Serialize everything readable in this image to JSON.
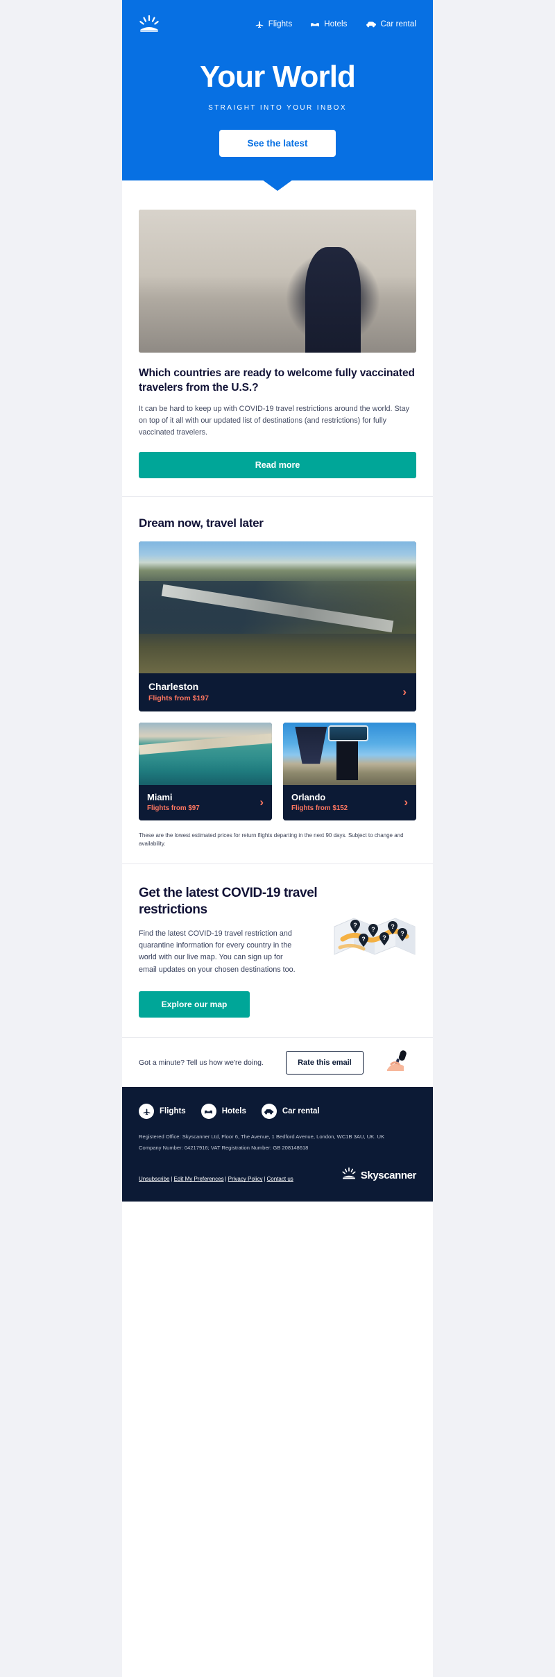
{
  "brand": {
    "name": "Skyscanner",
    "logo_icon": "sunrise-icon",
    "colors": {
      "hero_blue": "#0770e3",
      "teal": "#00a698",
      "navy": "#0c1a35",
      "coral": "#ff7761",
      "page_bg": "#f1f2f6"
    }
  },
  "hero": {
    "nav": [
      {
        "label": "Flights",
        "icon": "plane-icon"
      },
      {
        "label": "Hotels",
        "icon": "bed-icon"
      },
      {
        "label": "Car rental",
        "icon": "car-icon"
      }
    ],
    "title": "Your World",
    "subtitle": "STRAIGHT INTO YOUR INBOX",
    "cta_label": "See the latest"
  },
  "article": {
    "image_alt": "Woman wearing a face mask holding a phone on a city street",
    "title": "Which countries are ready to welcome fully vaccinated travelers from the U.S.?",
    "body": "It can be hard to keep up with COVID-19 travel restrictions around the world. Stay on top of it all with our updated list of destinations (and restrictions) for fully vaccinated travelers.",
    "cta_label": "Read more"
  },
  "dream": {
    "heading": "Dream now, travel later",
    "featured": {
      "name": "Charleston",
      "price": "Flights from $197",
      "image_alt": "Aerial view of Charleston harbor and bridge",
      "chevron_icon": "chevron-right-icon"
    },
    "cards": [
      {
        "name": "Miami",
        "price": "Flights from $97",
        "image_alt": "Miami beach coastline from the air",
        "chevron_icon": "chevron-right-icon"
      },
      {
        "name": "Orlando",
        "price": "Flights from $152",
        "image_alt": "Welcome to Orlando sign with palm trees and skyline",
        "chevron_icon": "chevron-right-icon"
      }
    ],
    "disclaimer": "These are the lowest estimated prices for return flights departing in the next 90 days. Subject to change and availability."
  },
  "covid": {
    "heading": "Get the latest COVID-19 travel restrictions",
    "body": "Find the latest COVID-19 travel restriction and quarantine information for every country in the world with our live map. You can sign up for email updates on your chosen destinations too.",
    "cta_label": "Explore our map",
    "art_alt": "Folded paper map with location pins"
  },
  "rate": {
    "prompt": "Got a minute? Tell us how we're doing.",
    "button_label": "Rate this email",
    "art_alt": "Hand holding a microphone"
  },
  "footer": {
    "nav": [
      {
        "label": "Flights",
        "icon": "plane-icon"
      },
      {
        "label": "Hotels",
        "icon": "bed-icon"
      },
      {
        "label": "Car rental",
        "icon": "car-icon"
      }
    ],
    "legal_line_1": "Registered Office: Skyscanner Ltd, Floor 6, The Avenue, 1 Bedford Avenue, London, WC1B 3AU, UK. UK",
    "legal_line_2": "Company Number: 04217916; VAT Registration Number: GB 208148618",
    "links": [
      {
        "label": "Unsubscribe"
      },
      {
        "label": "Edit My Preferences"
      },
      {
        "label": "Privacy Policy"
      },
      {
        "label": "Contact us"
      }
    ],
    "link_separator": "|",
    "logo_word": "Skyscanner",
    "logo_icon": "sunrise-icon"
  }
}
